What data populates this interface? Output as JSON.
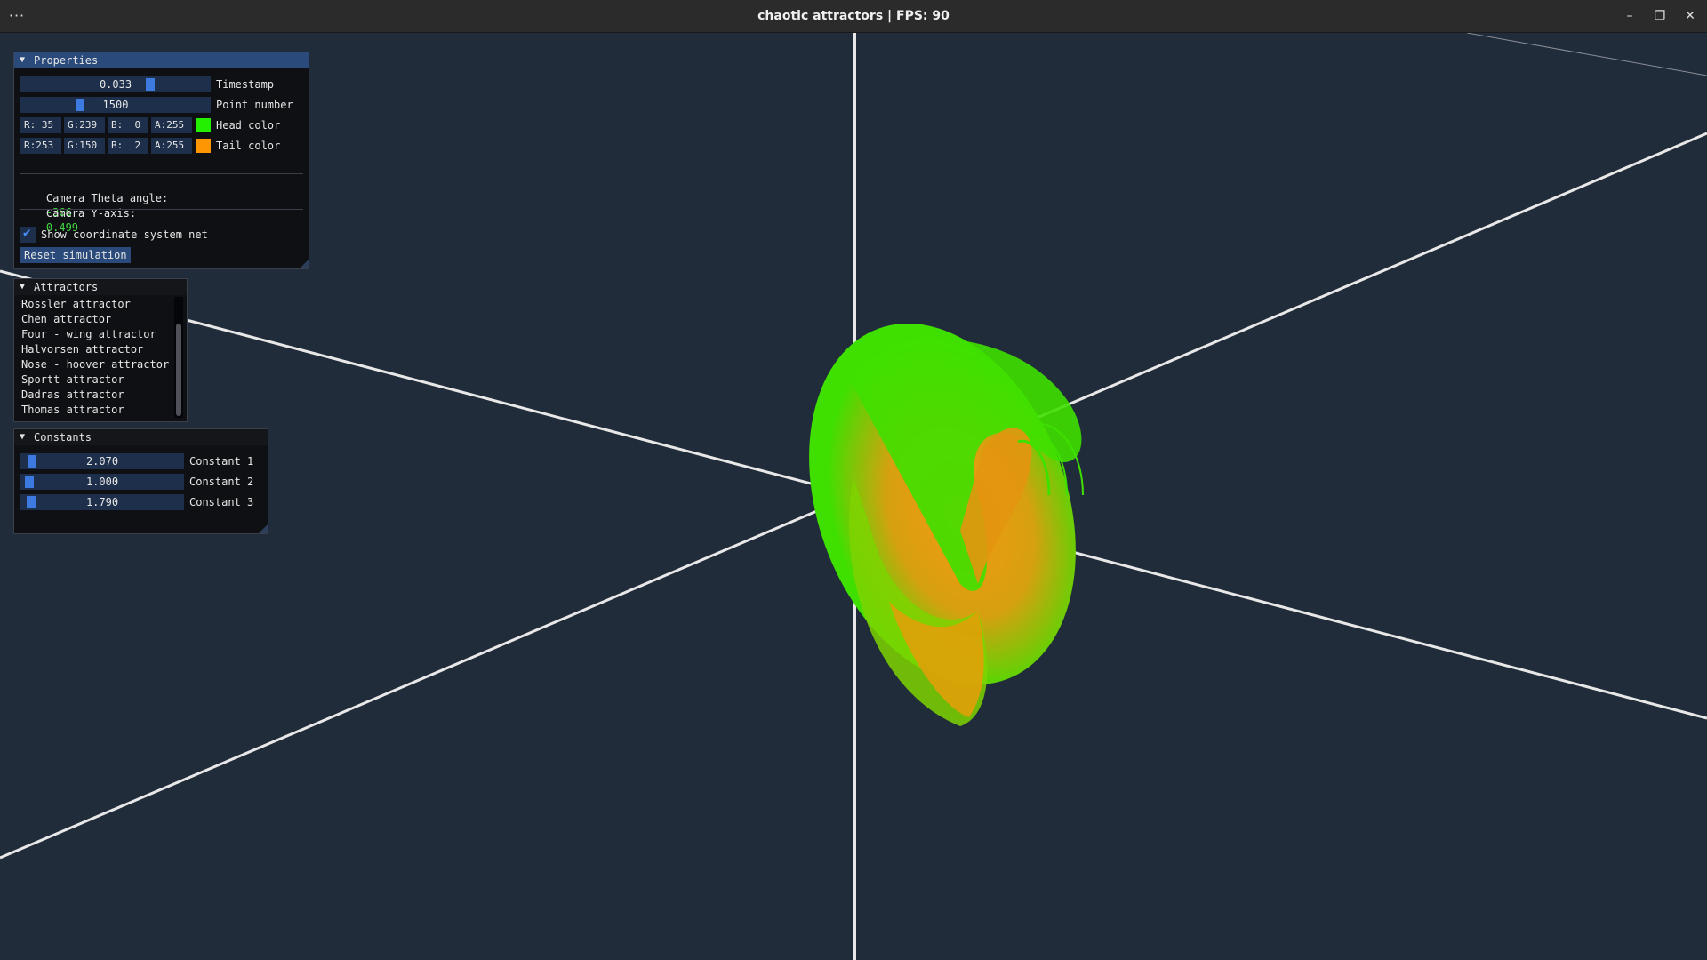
{
  "window": {
    "title": "chaotic attractors | FPS: 90",
    "menu_icon": "ellipsis-icon",
    "controls": [
      "minimize-icon",
      "maximize-icon",
      "close-icon"
    ]
  },
  "scene": {
    "background": "#212c3a",
    "axis_color": "#e8e8e8",
    "head_color": "#23ef00",
    "tail_color": "#fd9602"
  },
  "properties": {
    "title": "Properties",
    "timestamp": {
      "value": "0.033",
      "label": "Timestamp"
    },
    "point_number": {
      "value": "1500",
      "label": "Point number"
    },
    "head_color": {
      "r": "R: 35",
      "g": "G:239",
      "b": "B:  0",
      "a": "A:255",
      "label": "Head color"
    },
    "tail_color": {
      "r": "R:253",
      "g": "G:150",
      "b": "B:  2",
      "a": "A:255",
      "label": "Tail color"
    },
    "camera_theta_label": "Camera Theta angle:",
    "camera_theta_value": "-366",
    "camera_y_label": "Camera Y-axis:",
    "camera_y_value": "0.499",
    "show_net_label": "Show coordinate system net",
    "show_net_checked": true,
    "reset_label": "Reset simulation"
  },
  "attractors": {
    "title": "Attractors",
    "items": [
      "Rossler attractor",
      "Chen attractor",
      "Four - wing attractor",
      "Halvorsen attractor",
      "Nose - hoover attractor",
      "Sportt attractor",
      "Dadras attractor",
      "Thomas attractor"
    ]
  },
  "constants": {
    "title": "Constants",
    "items": [
      {
        "value": "2.070",
        "label": "Constant 1"
      },
      {
        "value": "1.000",
        "label": "Constant 2"
      },
      {
        "value": "1.790",
        "label": "Constant 3"
      }
    ]
  }
}
